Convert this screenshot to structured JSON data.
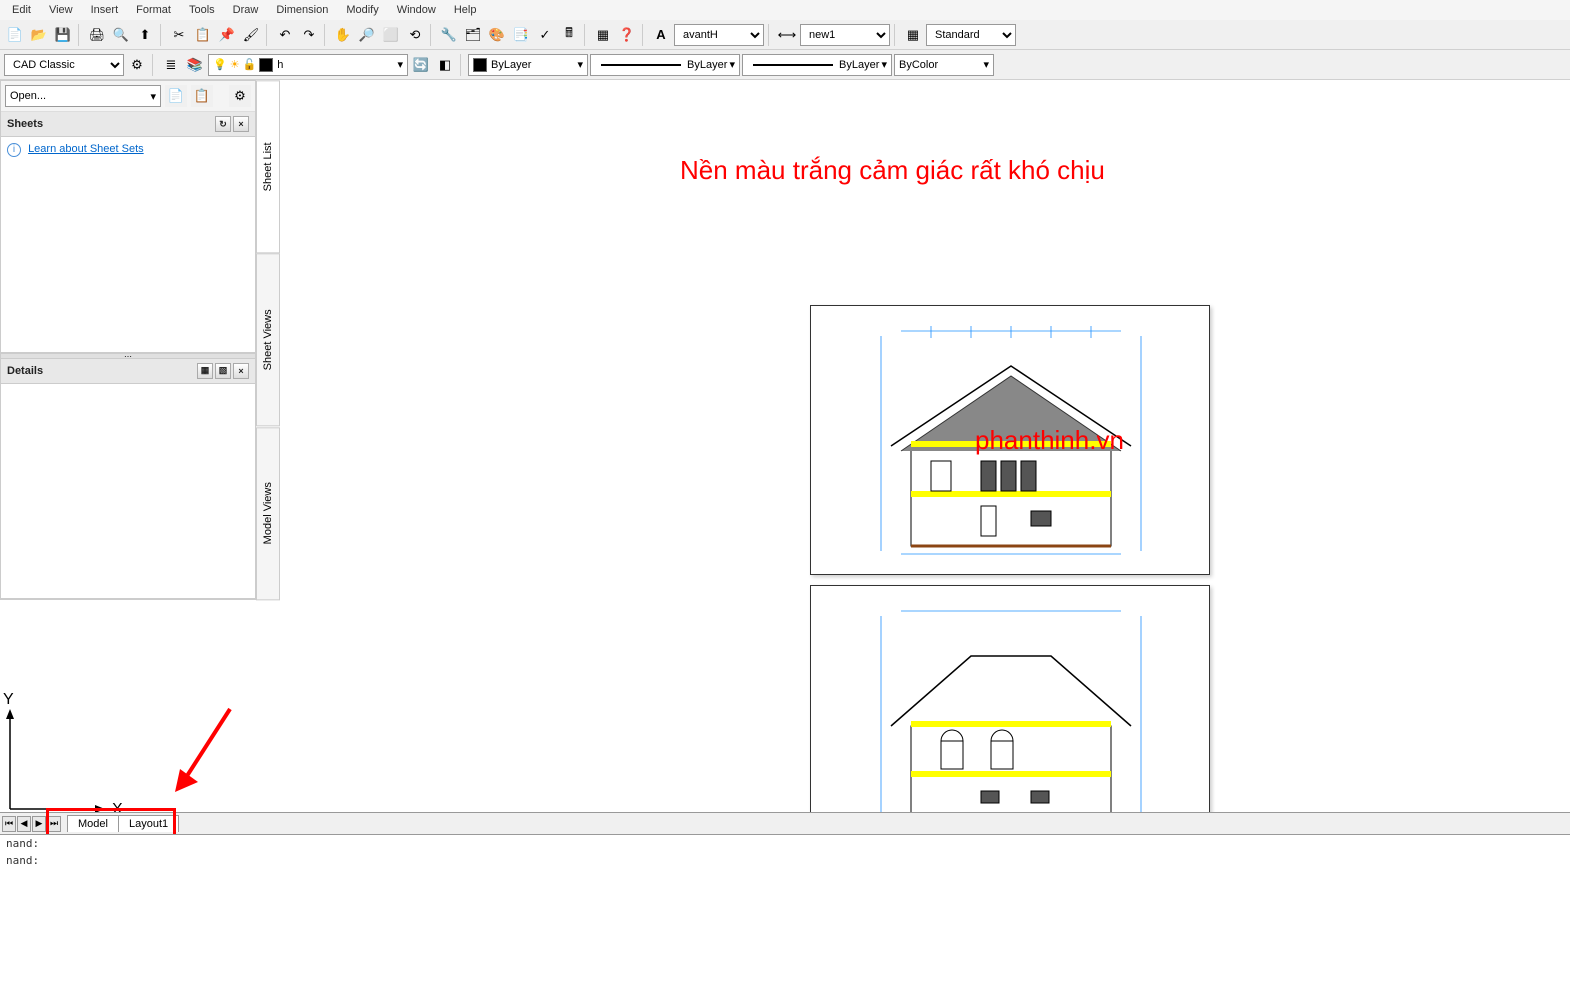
{
  "menu": {
    "items": [
      "Edit",
      "View",
      "Insert",
      "Format",
      "Tools",
      "Draw",
      "Dimension",
      "Modify",
      "Window",
      "Help"
    ]
  },
  "toolbar1": {
    "workspace": "CAD Classic",
    "font": "avantH",
    "dimstyle": "new1",
    "tablestyle": "Standard"
  },
  "toolbar2": {
    "layer": "h",
    "color_label": "ByLayer",
    "linetype_label": "ByLayer",
    "lineweight_label": "ByLayer",
    "plotstyle": "ByColor"
  },
  "panel": {
    "open_label": "Open...",
    "sheets_header": "Sheets",
    "learn_link": "Learn about Sheet Sets",
    "details_header": "Details"
  },
  "vtabs": {
    "items": [
      "Sheet List",
      "Sheet Views",
      "Model Views"
    ]
  },
  "annotations": {
    "line1": "Nền màu trắng cảm giác rất khó chịu",
    "watermark": "phanthinh.vn"
  },
  "tabs": {
    "model": "Model",
    "layout": "Layout1"
  },
  "ucs": {
    "x": "X",
    "y": "Y"
  },
  "command": {
    "prompt": "nand:"
  }
}
